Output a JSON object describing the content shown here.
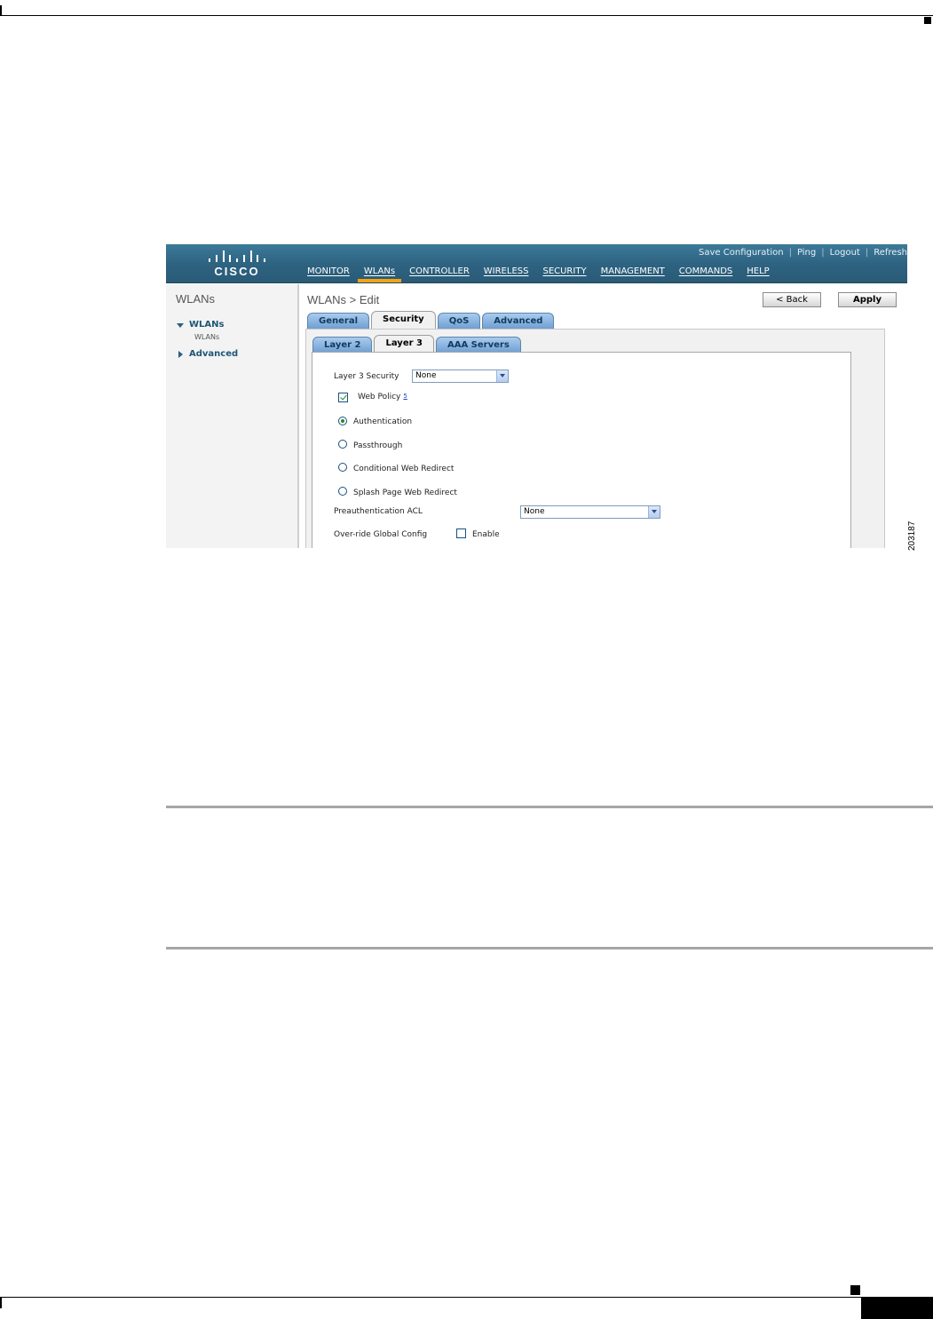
{
  "figure_id": "203187",
  "header": {
    "logo_text": "CISCO",
    "utility_links": [
      "Save Configuration",
      "Ping",
      "Logout",
      "Refresh"
    ],
    "nav": [
      "MONITOR",
      "WLANs",
      "CONTROLLER",
      "WIRELESS",
      "SECURITY",
      "MANAGEMENT",
      "COMMANDS",
      "HELP"
    ],
    "active_nav": "WLANs",
    "brand_color": "#2d6280",
    "active_accent": "#f2a413"
  },
  "sidebar": {
    "title": "WLANs",
    "group_label": "WLANs",
    "group_sub_item": "WLANs",
    "advanced_label": "Advanced"
  },
  "main": {
    "breadcrumb": "WLANs > Edit",
    "back_label": "< Back",
    "apply_label": "Apply",
    "tabs": [
      "General",
      "Security",
      "QoS",
      "Advanced"
    ],
    "active_tab": "Security",
    "subtabs": [
      "Layer 2",
      "Layer 3",
      "AAA Servers"
    ],
    "active_subtab": "Layer 3",
    "form": {
      "l3_security_label": "Layer 3 Security",
      "l3_security_value": "None",
      "web_policy_label": "Web Policy",
      "web_policy_footnote": "5",
      "web_policy_checked": true,
      "options": [
        "Authentication",
        "Passthrough",
        "Conditional Web Redirect",
        "Splash Page Web Redirect"
      ],
      "selected_option": "Authentication",
      "preauth_acl_label": "Preauthentication ACL",
      "preauth_acl_value": "None",
      "override_label": "Over-ride Global Config",
      "override_enable_label": "Enable",
      "override_checked": false
    }
  }
}
